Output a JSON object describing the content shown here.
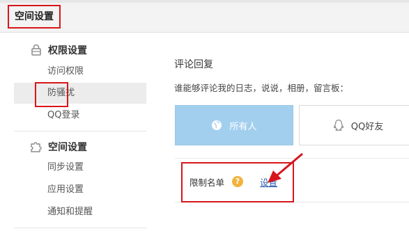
{
  "header": {
    "title": "空间设置"
  },
  "sidebar": {
    "sections": [
      {
        "title": "权限设置",
        "icon": "lock-icon",
        "items": [
          {
            "label": "访问权限"
          },
          {
            "label": "防骚扰"
          },
          {
            "label": "QQ登录"
          }
        ]
      },
      {
        "title": "空间设置",
        "icon": "puzzle-icon",
        "items": [
          {
            "label": "同步设置"
          },
          {
            "label": "应用设置"
          },
          {
            "label": "通知和提醒"
          }
        ]
      }
    ],
    "active_item": "防骚扰"
  },
  "main": {
    "title": "评论回复",
    "desc": "谁能够评论我的日志，说说，相册，留言板：",
    "options": [
      {
        "label": "所有人",
        "icon": "globe-icon",
        "selected": true
      },
      {
        "label": "QQ好友",
        "icon": "qq-penguin-icon",
        "selected": false
      }
    ],
    "limit": {
      "label": "限制名单",
      "help": "?",
      "link": "设置"
    }
  },
  "colors": {
    "highlight": "#d6161b",
    "selected_option": "#a3cfee",
    "link": "#2a5db0",
    "help": "#f2b33d"
  }
}
